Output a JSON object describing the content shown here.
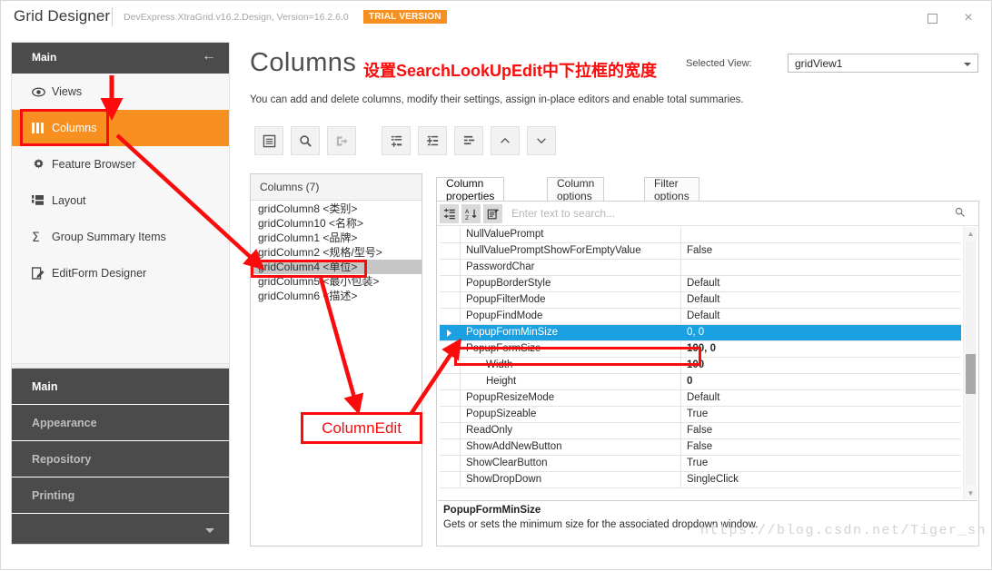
{
  "window": {
    "app_title": "Grid Designer",
    "assembly": "DevExpress.XtraGrid.v16.2.Design, Version=16.2.6.0",
    "trial_badge": "TRIAL VERSION",
    "maximize_label": "",
    "close_label": "×"
  },
  "nav": {
    "header": "Main",
    "back_icon": "←",
    "items": [
      {
        "label": "Views",
        "icon": "eye-icon",
        "active": false
      },
      {
        "label": "Columns",
        "icon": "columns-icon",
        "active": true
      },
      {
        "label": "Feature Browser",
        "icon": "gear-icon",
        "active": false
      },
      {
        "label": "Layout",
        "icon": "layout-icon",
        "active": false
      },
      {
        "label": "Group Summary Items",
        "icon": "sigma-icon",
        "active": false
      },
      {
        "label": "EditForm Designer",
        "icon": "edit-form-icon",
        "active": false
      }
    ],
    "splitter_dots": "···",
    "groups": [
      {
        "label": "Main",
        "selected": true
      },
      {
        "label": "Appearance",
        "selected": false
      },
      {
        "label": "Repository",
        "selected": false
      },
      {
        "label": "Printing",
        "selected": false
      }
    ]
  },
  "header": {
    "title": "Columns",
    "annotation_zh": "设置SearchLookUpEdit中下拉框的宽度",
    "selected_view_label": "Selected View:",
    "selected_view_value": "gridView1",
    "description": "You can add and delete columns, modify their settings, assign in-place editors and enable total summaries."
  },
  "toolbar": {
    "buttons": [
      {
        "name": "add-column-button",
        "icon": "list-icon",
        "dim": false
      },
      {
        "name": "retrieve-fields-button",
        "icon": "search-icon",
        "dim": false
      },
      {
        "name": "populate-columns-button",
        "icon": "export-icon",
        "dim": true
      },
      {
        "name": "add-band-button",
        "icon": "add-row-icon",
        "dim": false
      },
      {
        "name": "insert-row-button",
        "icon": "insert-row-icon",
        "dim": false
      },
      {
        "name": "remove-row-button",
        "icon": "remove-row-icon",
        "dim": false
      },
      {
        "name": "move-up-button",
        "icon": "chevron-up-icon",
        "dim": false
      },
      {
        "name": "move-down-button",
        "icon": "chevron-down-icon",
        "dim": false
      }
    ]
  },
  "columns_panel": {
    "header": "Columns (7)",
    "items": [
      {
        "label": "gridColumn8 <类别>",
        "selected": false
      },
      {
        "label": "gridColumn10 <名称>",
        "selected": false
      },
      {
        "label": "gridColumn1 <品牌>",
        "selected": false
      },
      {
        "label": "gridColumn2 <规格/型号>",
        "selected": false
      },
      {
        "label": "gridColumn4 <单位>",
        "selected": true
      },
      {
        "label": "gridColumn5 <最小包装>",
        "selected": false
      },
      {
        "label": "gridColumn6 <描述>",
        "selected": false
      }
    ]
  },
  "property_panel": {
    "tabs": [
      {
        "label": "Column properties",
        "active": true
      },
      {
        "label": "Column options",
        "active": false
      },
      {
        "label": "Filter options",
        "active": false
      }
    ],
    "pg_buttons": [
      {
        "name": "categorized-button",
        "icon": "categorized-icon"
      },
      {
        "name": "alphabetical-sort-button",
        "icon": "sort-az-icon"
      },
      {
        "name": "property-pages-button",
        "icon": "property-pages-icon"
      }
    ],
    "search_placeholder": "Enter text to search...",
    "search_value": "",
    "search_icon": "search-icon",
    "rows": [
      {
        "name": "NullValuePrompt",
        "value": "",
        "indent": false,
        "expander": "none",
        "selected": false,
        "bold": false
      },
      {
        "name": "NullValuePromptShowForEmptyValue",
        "value": "False",
        "indent": false,
        "expander": "none",
        "selected": false,
        "bold": false
      },
      {
        "name": "PasswordChar",
        "value": "",
        "indent": false,
        "expander": "none",
        "selected": false,
        "bold": false
      },
      {
        "name": "PopupBorderStyle",
        "value": "Default",
        "indent": false,
        "expander": "none",
        "selected": false,
        "bold": false
      },
      {
        "name": "PopupFilterMode",
        "value": "Default",
        "indent": false,
        "expander": "none",
        "selected": false,
        "bold": false
      },
      {
        "name": "PopupFindMode",
        "value": "Default",
        "indent": false,
        "expander": "none",
        "selected": false,
        "bold": false
      },
      {
        "name": "PopupFormMinSize",
        "value": "0, 0",
        "indent": false,
        "expander": "collapsed",
        "selected": true,
        "bold": false
      },
      {
        "name": "PopupFormSize",
        "value": "100, 0",
        "indent": false,
        "expander": "expanded",
        "selected": false,
        "bold": true
      },
      {
        "name": "Width",
        "value": "100",
        "indent": true,
        "expander": "none",
        "selected": false,
        "bold": true
      },
      {
        "name": "Height",
        "value": "0",
        "indent": true,
        "expander": "none",
        "selected": false,
        "bold": true
      },
      {
        "name": "PopupResizeMode",
        "value": "Default",
        "indent": false,
        "expander": "none",
        "selected": false,
        "bold": false
      },
      {
        "name": "PopupSizeable",
        "value": "True",
        "indent": false,
        "expander": "none",
        "selected": false,
        "bold": false
      },
      {
        "name": "ReadOnly",
        "value": "False",
        "indent": false,
        "expander": "none",
        "selected": false,
        "bold": false
      },
      {
        "name": "ShowAddNewButton",
        "value": "False",
        "indent": false,
        "expander": "none",
        "selected": false,
        "bold": false
      },
      {
        "name": "ShowClearButton",
        "value": "True",
        "indent": false,
        "expander": "none",
        "selected": false,
        "bold": false
      },
      {
        "name": "ShowDropDown",
        "value": "SingleClick",
        "indent": false,
        "expander": "none",
        "selected": false,
        "bold": false
      }
    ],
    "description_title": "PopupFormMinSize",
    "description_body": "Gets or sets the minimum size for the associated dropdown window.",
    "scroll_up_icon": "▲",
    "scroll_down_icon": "▼"
  },
  "annotations": {
    "callout_label": "ColumnEdit",
    "accent_red": "#fb0b0b",
    "accent_orange": "#f79020",
    "selection_blue": "#1ba1e2",
    "watermark": "https://blog.csdn.net/Tiger_sh"
  }
}
